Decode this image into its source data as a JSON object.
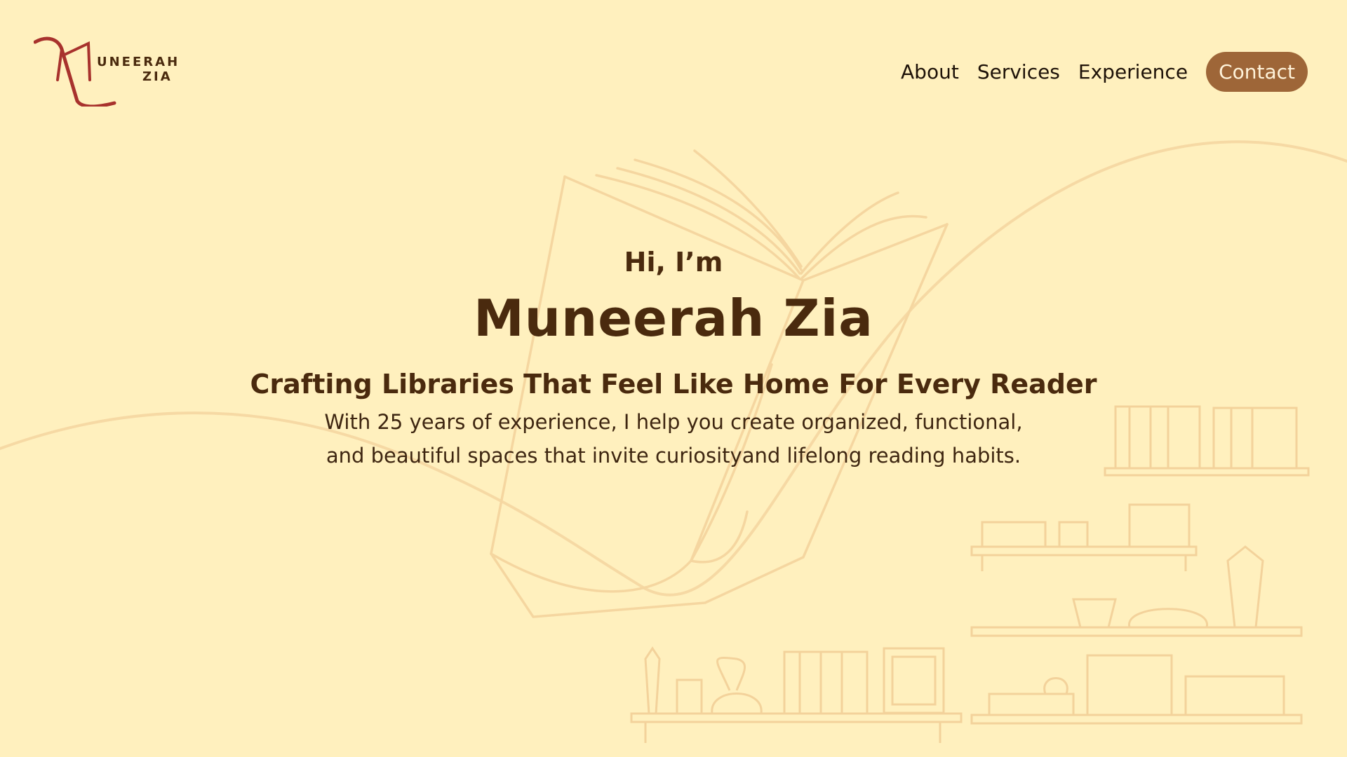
{
  "brand": {
    "logo_initial": "M",
    "logo_line1": "UNEERAH",
    "logo_line2": "ZIA"
  },
  "nav": {
    "items": [
      "About",
      "Services",
      "Experience"
    ],
    "contact_label": "Contact"
  },
  "hero": {
    "greeting": "Hi, I’m",
    "name": "Muneerah Zia",
    "tagline": "Crafting Libraries That Feel Like Home For Every Reader",
    "description": "With 25 years of experience, I help you create organized, functional, and beautiful spaces that invite curiosityand lifelong reading habits."
  },
  "colors": {
    "background": "#FFF0BE",
    "primary_text": "#4A2A0E",
    "accent_button": "#9E6638",
    "logo_red": "#A8322D",
    "line_art": "#F3D29B"
  },
  "icons": {
    "book": "open-book-illustration",
    "shelves": "bookshelf-illustration"
  }
}
